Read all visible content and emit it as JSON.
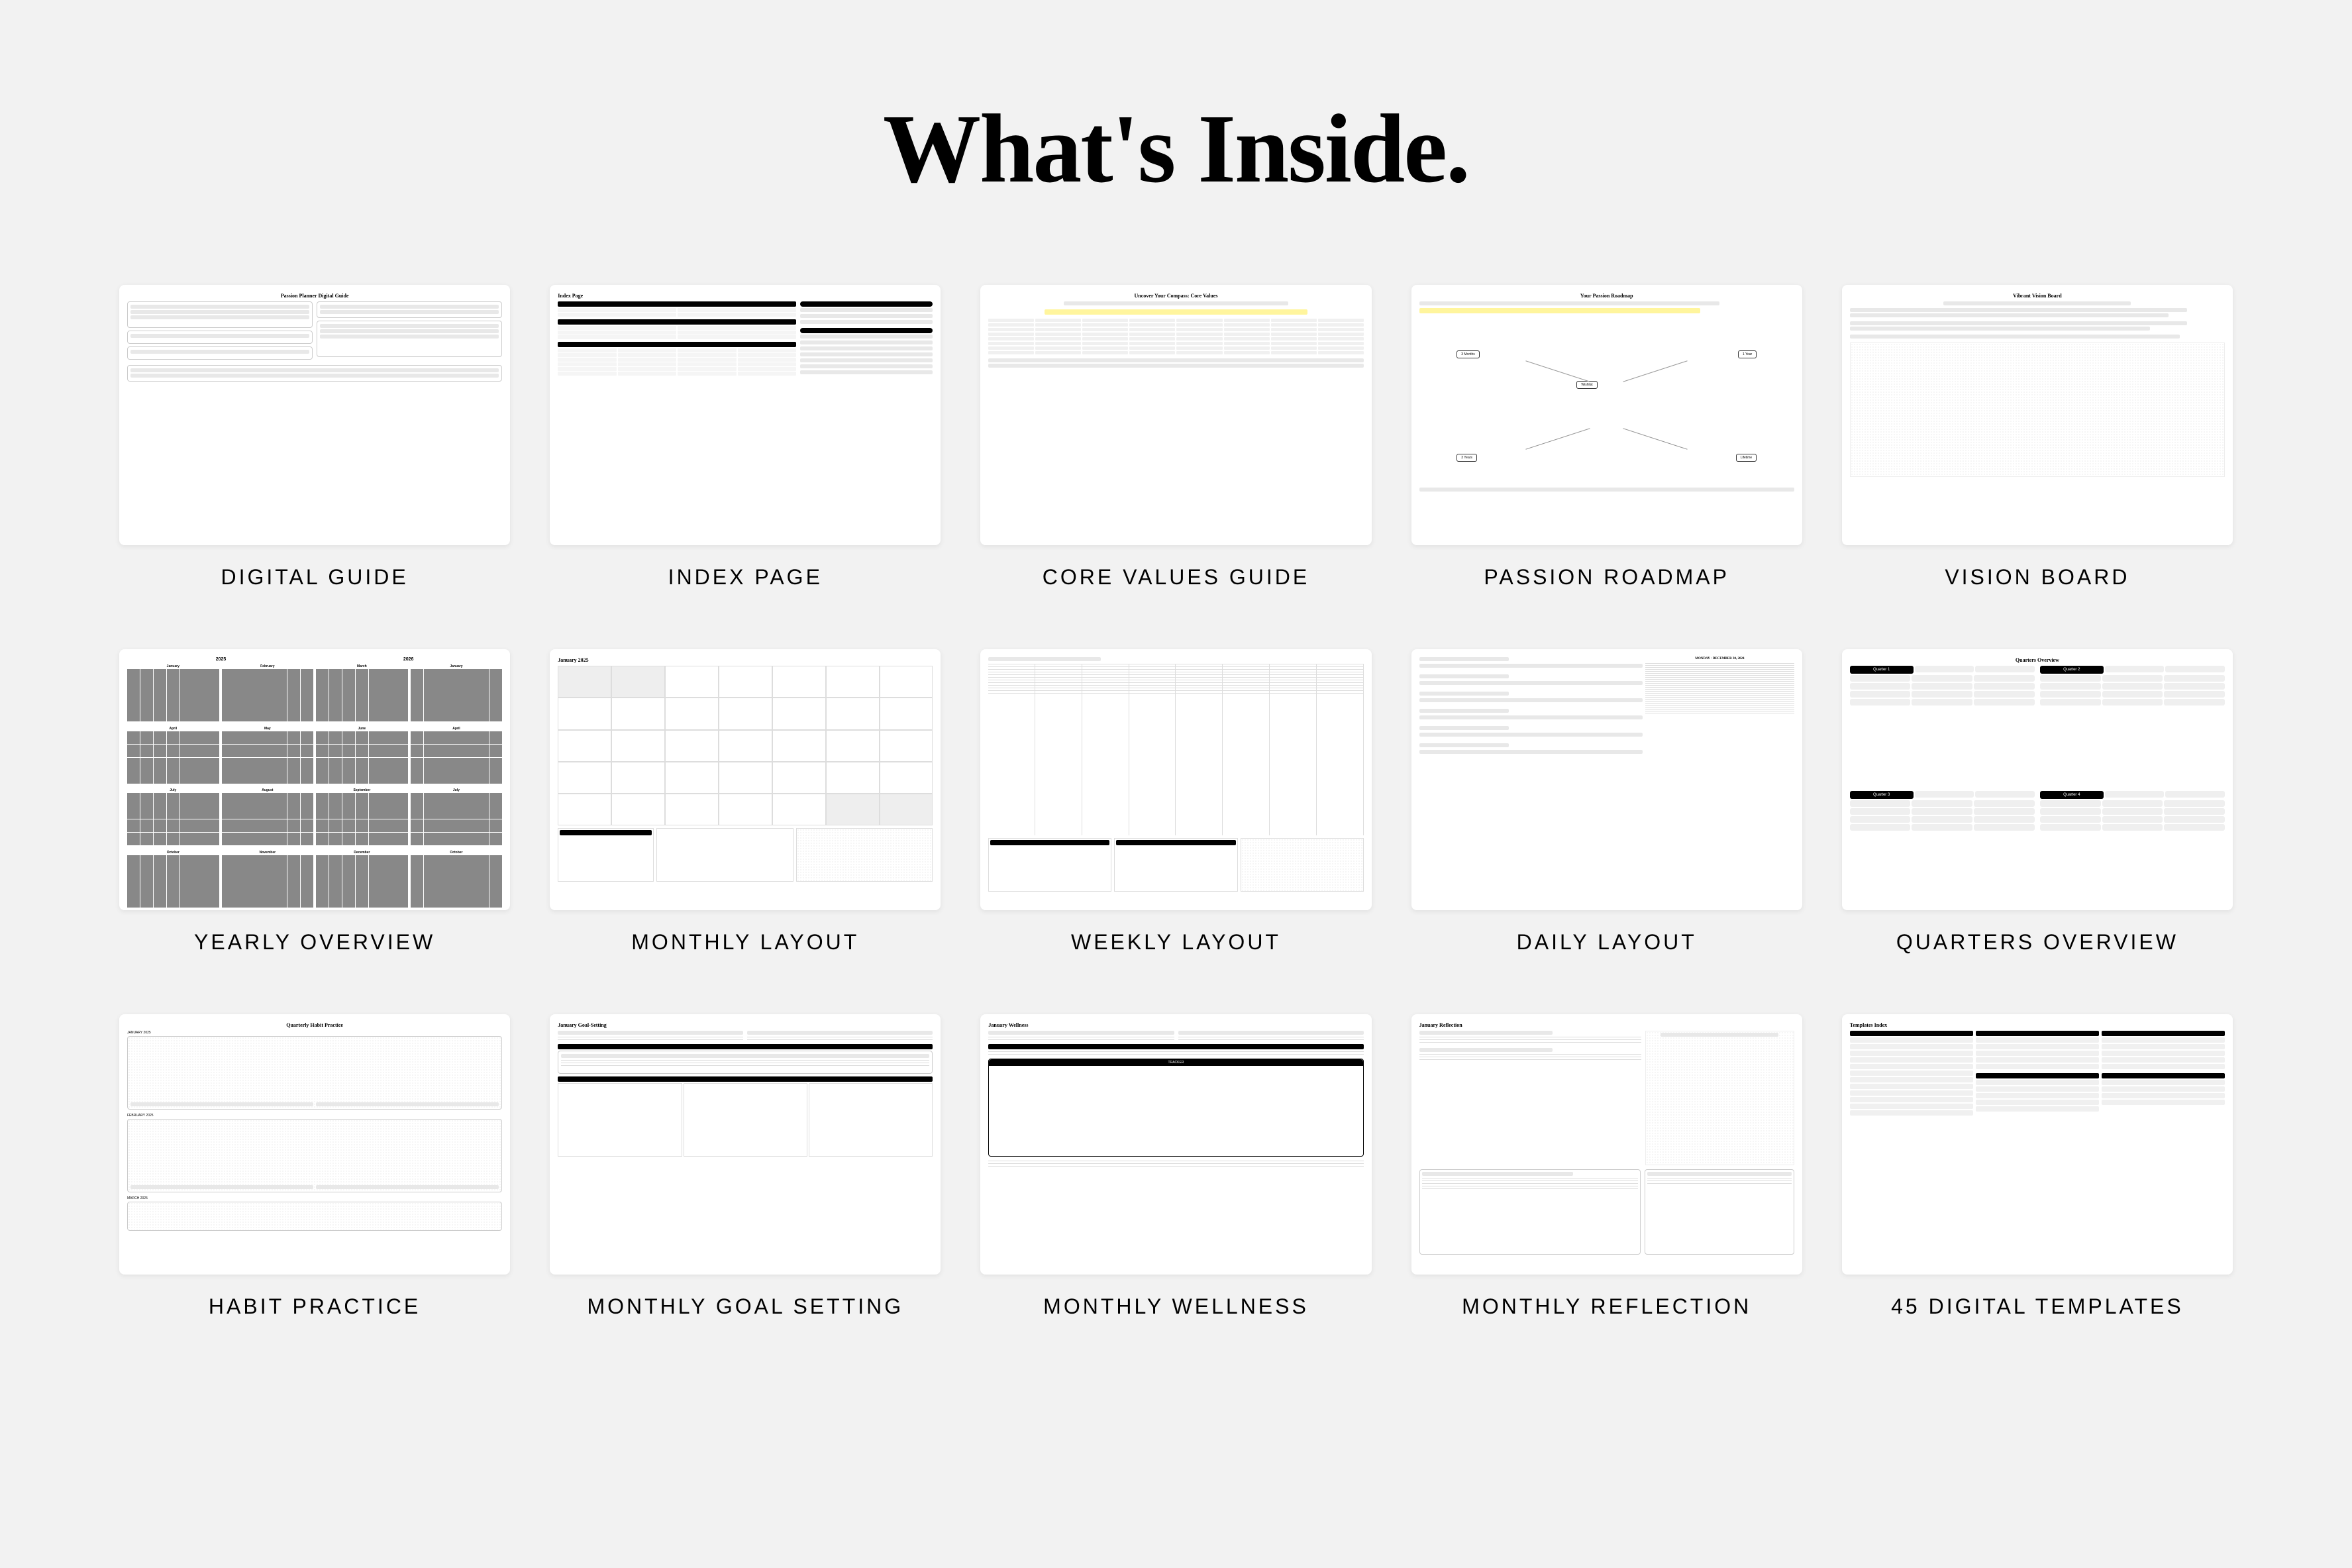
{
  "title": "What's Inside.",
  "items": [
    {
      "label": "DIGITAL GUIDE",
      "thumb_title": "Passion Planner Digital Guide"
    },
    {
      "label": "INDEX PAGE",
      "thumb_title": "Index Page"
    },
    {
      "label": "CORE VALUES GUIDE",
      "thumb_title": "Uncover Your Compass: Core Values"
    },
    {
      "label": "PASSION ROADMAP",
      "thumb_title": "Your Passion Roadmap"
    },
    {
      "label": "VISION BOARD",
      "thumb_title": "Vibrant Vision Board"
    },
    {
      "label": "YEARLY OVERVIEW",
      "thumb_title": "2025 · 2026"
    },
    {
      "label": "MONTHLY LAYOUT",
      "thumb_title": "January 2025"
    },
    {
      "label": "WEEKLY LAYOUT",
      "thumb_title": ""
    },
    {
      "label": "DAILY LAYOUT",
      "thumb_title": "MONDAY · DECEMBER 30, 2024"
    },
    {
      "label": "QUARTERS OVERVIEW",
      "thumb_title": "Quarters Overview",
      "quarters": [
        "Quarter 1",
        "Quarter 2",
        "Quarter 3",
        "Quarter 4"
      ]
    },
    {
      "label": "HABIT PRACTICE",
      "thumb_title": "Quarterly Habit Practice"
    },
    {
      "label": "MONTHLY GOAL SETTING",
      "thumb_title": "January Goal-Setting"
    },
    {
      "label": "MONTHLY WELLNESS",
      "thumb_title": "January Wellness"
    },
    {
      "label": "MONTHLY REFLECTION",
      "thumb_title": "January Reflection"
    },
    {
      "label": "45 DIGITAL TEMPLATES",
      "thumb_title": "Templates Index"
    }
  ]
}
